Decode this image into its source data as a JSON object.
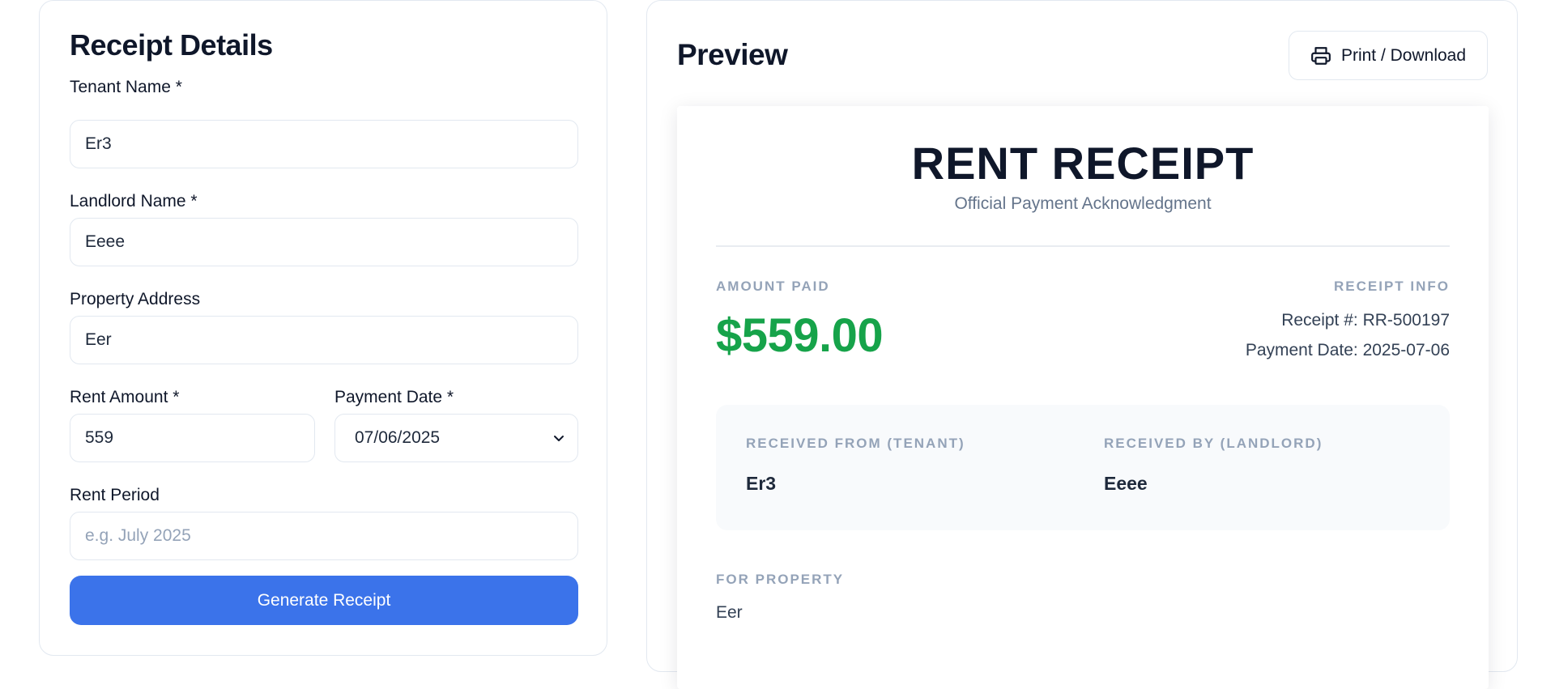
{
  "form": {
    "title": "Receipt Details",
    "tenant_label": "Tenant Name *",
    "tenant_value": "Er3",
    "landlord_label": "Landlord Name *",
    "landlord_value": "Eeee",
    "address_label": "Property Address",
    "address_value": "Eer",
    "amount_label": "Rent Amount *",
    "amount_value": "559",
    "date_label": "Payment Date *",
    "date_value": "07/06/2025",
    "period_label": "Rent Period",
    "period_placeholder": "e.g. July 2025",
    "generate_label": "Generate Receipt"
  },
  "preview": {
    "title": "Preview",
    "print_label": "Print / Download",
    "receipt": {
      "heading": "RENT RECEIPT",
      "subheading": "Official Payment Acknowledgment",
      "amount_label": "AMOUNT PAID",
      "amount_value": "$559.00",
      "info_label": "RECEIPT INFO",
      "receipt_no_label": "Receipt #:",
      "receipt_no_value": "RR-500197",
      "payment_date_label": "Payment Date:",
      "payment_date_value": "2025-07-06",
      "from_label": "RECEIVED FROM (TENANT)",
      "from_value": "Er3",
      "by_label": "RECEIVED BY (LANDLORD)",
      "by_value": "Eeee",
      "property_label": "FOR PROPERTY",
      "property_value": "Eer"
    }
  },
  "colors": {
    "primary_button": "#3b73ea",
    "amount_green": "#16a34a",
    "muted_label": "#94a3b8"
  },
  "icons": {
    "print": "printer-icon",
    "select": "chevron-down-icon"
  }
}
